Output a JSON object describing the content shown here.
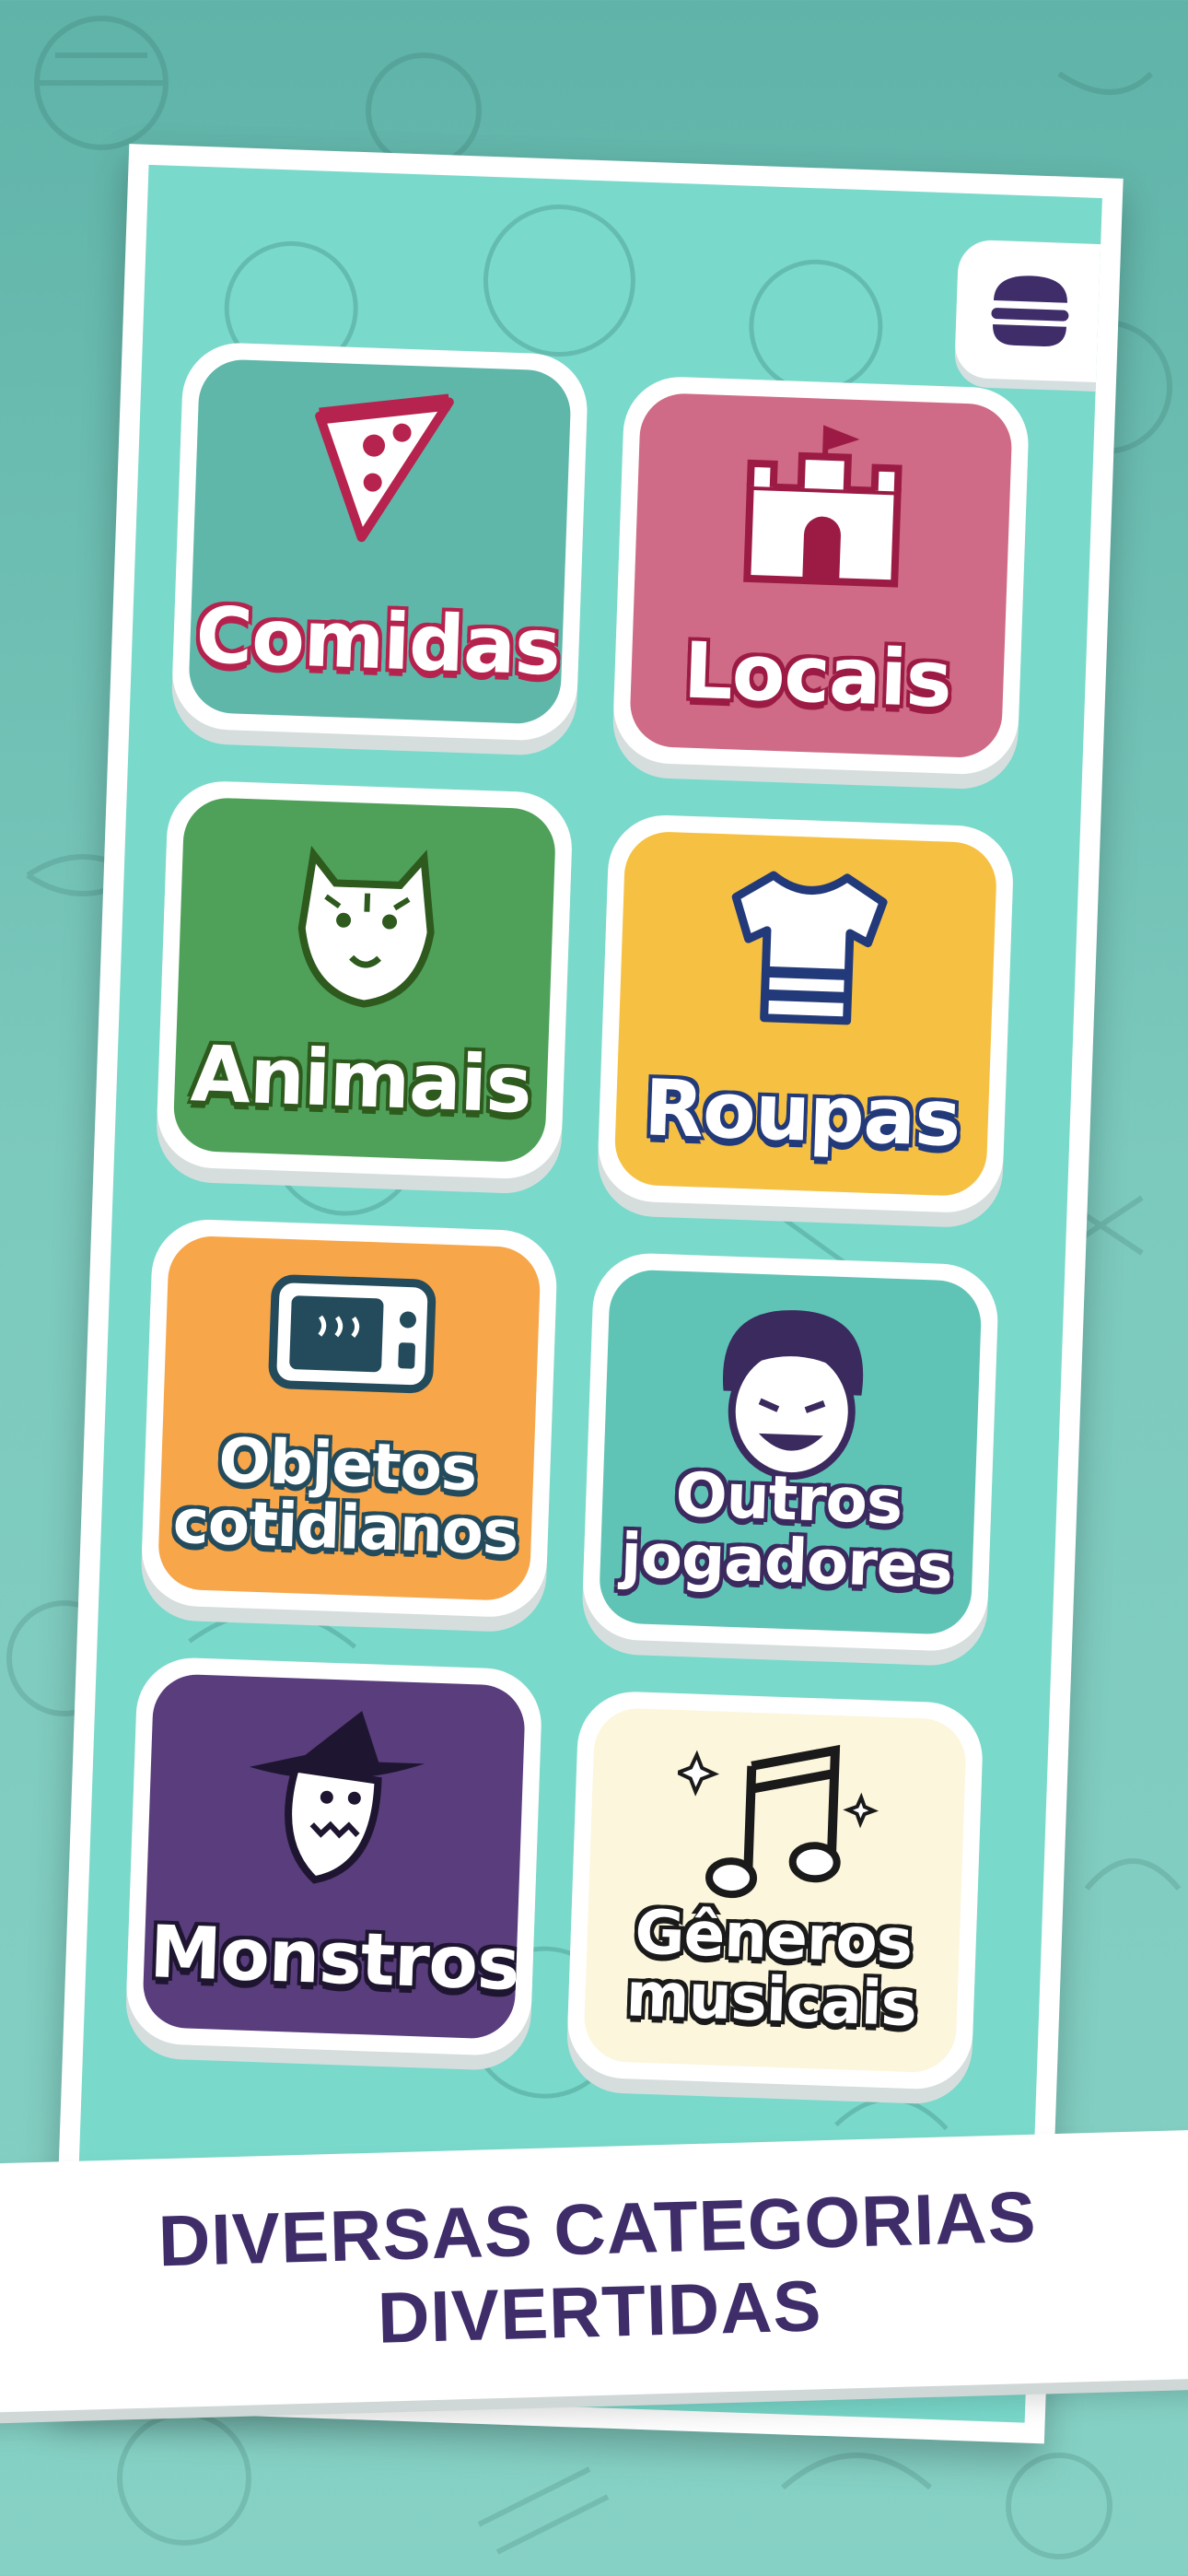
{
  "menu": {
    "icon": "hamburger-icon"
  },
  "categories": [
    {
      "label": "Comidas",
      "icon": "pizza-icon",
      "bg": "#5fb7aa",
      "outline": "#b5234e"
    },
    {
      "label": "Locais",
      "icon": "castle-icon",
      "bg": "#cf6b86",
      "outline": "#9c1b45"
    },
    {
      "label": "Animais",
      "icon": "tiger-icon",
      "bg": "#4fa15a",
      "outline": "#2e5a1e"
    },
    {
      "label": "Roupas",
      "icon": "shirt-icon",
      "bg": "#f6c143",
      "outline": "#233a7a"
    },
    {
      "label": "Objetos cotidianos",
      "icon": "microwave-icon",
      "bg": "#f7a64a",
      "outline": "#244b5c"
    },
    {
      "label": "Outros jogadores",
      "icon": "player-face-icon",
      "bg": "#5fc4b6",
      "outline": "#3b2a5e"
    },
    {
      "label": "Monstros",
      "icon": "witch-icon",
      "bg": "#5a3d7d",
      "outline": "#1e1630"
    },
    {
      "label": "Gêneros musicais",
      "icon": "music-notes-icon",
      "bg": "#fbf6dc",
      "outline": "#1a1a1a"
    }
  ],
  "banner": {
    "line1": "DIVERSAS CATEGORIAS",
    "line2": "DIVERTIDAS"
  },
  "colors": {
    "accent": "#3f2d6a",
    "screen": "#79d9cb"
  }
}
